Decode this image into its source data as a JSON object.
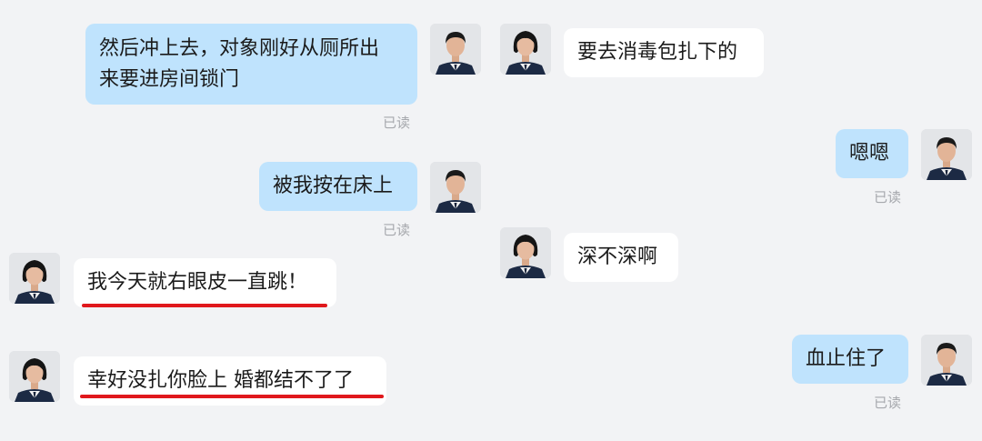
{
  "read_label": "已读",
  "messages_left": [
    {
      "text": "然后冲上去，对象刚好从厕所出\n来要进房间锁门",
      "from": "officer-male",
      "read": true
    },
    {
      "text": "被我按在床上",
      "from": "officer-male",
      "read": true
    },
    {
      "text": "我今天就右眼皮一直跳！",
      "from": "officer-female",
      "underlined": true
    },
    {
      "text": "幸好没扎你脸上 婚都结不了了",
      "from": "officer-female",
      "underlined": true
    }
  ],
  "messages_right": [
    {
      "text": "要去消毒包扎下的",
      "from": "officer-female"
    },
    {
      "text": "嗯嗯",
      "from": "officer-male",
      "read": true
    },
    {
      "text": "深不深啊",
      "from": "officer-female"
    },
    {
      "text": "血止住了",
      "from": "officer-male",
      "read": true
    }
  ],
  "colors": {
    "background": "#f2f3f5",
    "sent_bubble": "#bfe3fd",
    "received_bubble": "#ffffff",
    "underline": "#e0181c",
    "read_text": "#a6a8ad"
  },
  "icons": [
    "avatar-male-officer",
    "avatar-female-officer"
  ]
}
